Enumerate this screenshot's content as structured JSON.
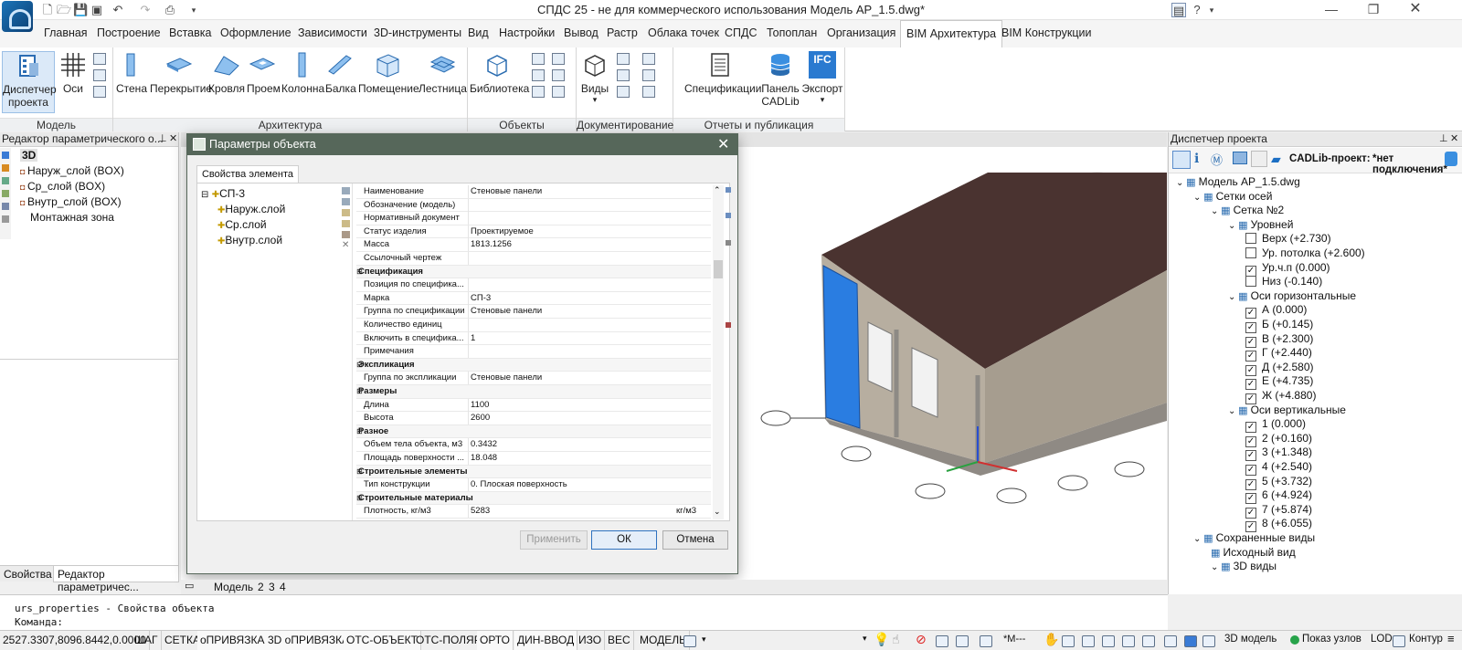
{
  "window": {
    "title": "СПДС 25 - не для коммерческого использования Модель AP_1.5.dwg*"
  },
  "menu_tabs": [
    "Главная",
    "Построение",
    "Вставка",
    "Оформление",
    "Зависимости",
    "3D-инструменты",
    "Вид",
    "Настройки",
    "Вывод",
    "Растр",
    "Облака точек",
    "СПДС",
    "Топоплан",
    "Организация",
    "BIM Архитектура",
    "BIM Конструкции"
  ],
  "active_tab": "BIM Архитектура",
  "ribbon": {
    "model": {
      "title": "Модель",
      "dispatcher": "Диспетчер\nпроекта",
      "axes": "Оси"
    },
    "architecture": {
      "title": "Архитектура",
      "buttons": [
        "Стена",
        "Перекрытие",
        "Кровля",
        "Проем",
        "Колонна",
        "Балка",
        "Помещение",
        "Лестница"
      ]
    },
    "objects": {
      "title": "Объекты",
      "library": "Библиотека"
    },
    "documentation": {
      "title": "Документирование",
      "views": "Виды"
    },
    "reports": {
      "title": "Отчеты и публикация",
      "specs": "Спецификации",
      "cadlib": "Панель\nCADLib",
      "export": "Экспорт",
      "ifc_label": "IFC"
    }
  },
  "left_panel": {
    "title": "Редактор параметрического о...",
    "root": "3D",
    "items": [
      "Наруж_слой (BOX)",
      "Ср_слой (BOX)",
      "Внутр_слой (BOX)",
      "Монтажная зона"
    ],
    "bottom_tabs": [
      "Свойства",
      "Редактор параметричес..."
    ]
  },
  "model_tabs": [
    "Модель",
    "2",
    "3",
    "4"
  ],
  "dialog": {
    "title": "Параметры объекта",
    "tab": "Свойства элемента",
    "tree_root": "СП-3",
    "tree_children": [
      "Наруж.слой",
      "Ср.слой",
      "Внутр.слой"
    ],
    "rows": [
      {
        "k": "Наименование",
        "v": "Стеновые панели"
      },
      {
        "k": "Обозначение (модель)",
        "v": ""
      },
      {
        "k": "Нормативный документ",
        "v": ""
      },
      {
        "k": "Статус изделия",
        "v": "Проектируемое"
      },
      {
        "k": "Масса",
        "v": "1813.1256"
      },
      {
        "k": "Ссылочный чертеж",
        "v": ""
      },
      {
        "k": "Спецификация",
        "v": "",
        "sec": true
      },
      {
        "k": "Позиция по специфика...",
        "v": ""
      },
      {
        "k": "Марка",
        "v": "СП-3"
      },
      {
        "k": "Группа по спецификации",
        "v": "Стеновые панели"
      },
      {
        "k": "Количество единиц",
        "v": ""
      },
      {
        "k": "Включить в специфика...",
        "v": "1"
      },
      {
        "k": "Примечания",
        "v": ""
      },
      {
        "k": "Экспликация",
        "v": "",
        "sec": true
      },
      {
        "k": "Группа по экспликации",
        "v": "Стеновые панели"
      },
      {
        "k": "Размеры",
        "v": "",
        "sec": true
      },
      {
        "k": "Длина",
        "v": "1100"
      },
      {
        "k": "Высота",
        "v": "2600"
      },
      {
        "k": "Разное",
        "v": "",
        "sec": true
      },
      {
        "k": "Объем тела объекта, м3",
        "v": "0.3432"
      },
      {
        "k": "Площадь поверхности ...",
        "v": "18.048"
      },
      {
        "k": "Строительные элементы",
        "v": "",
        "sec": true
      },
      {
        "k": "Тип конструкции",
        "v": "0. Плоская поверхность"
      },
      {
        "k": "Строительные материалы",
        "v": "",
        "sec": true
      },
      {
        "k": "Плотность, кг/м3",
        "v": "5283",
        "unit": "кг/м3"
      }
    ],
    "apply": "Применить",
    "ok": "ОК",
    "cancel": "Отмена"
  },
  "right_panel": {
    "title": "Диспетчер проекта",
    "cadlib_label": "CADLib-проект:",
    "cadlib_status": "*нет подключения*",
    "tree": [
      {
        "t": "Модель АР_1.5.dwg",
        "lvl": 0,
        "exp": "v"
      },
      {
        "t": "Сетки осей",
        "lvl": 1,
        "exp": "v"
      },
      {
        "t": "Сетка №2",
        "lvl": 2,
        "exp": "v"
      },
      {
        "t": "Уровней",
        "lvl": 3,
        "exp": "v"
      },
      {
        "t": "Верх (+2.730)",
        "lvl": 4,
        "chk": false
      },
      {
        "t": "Ур. потолка (+2.600)",
        "lvl": 4,
        "chk": false
      },
      {
        "t": "Ур.ч.п (0.000)",
        "lvl": 4,
        "chk": true
      },
      {
        "t": "Низ (-0.140)",
        "lvl": 4,
        "chk": false
      },
      {
        "t": "Оси горизонтальные",
        "lvl": 3,
        "exp": "v"
      },
      {
        "t": "А (0.000)",
        "lvl": 4,
        "chk": true
      },
      {
        "t": "Б (+0.145)",
        "lvl": 4,
        "chk": true
      },
      {
        "t": "В (+2.300)",
        "lvl": 4,
        "chk": true
      },
      {
        "t": "Г (+2.440)",
        "lvl": 4,
        "chk": true
      },
      {
        "t": "Д (+2.580)",
        "lvl": 4,
        "chk": true
      },
      {
        "t": "Е (+4.735)",
        "lvl": 4,
        "chk": true
      },
      {
        "t": "Ж (+4.880)",
        "lvl": 4,
        "chk": true
      },
      {
        "t": "Оси вертикальные",
        "lvl": 3,
        "exp": "v"
      },
      {
        "t": "1 (0.000)",
        "lvl": 4,
        "chk": true
      },
      {
        "t": "2 (+0.160)",
        "lvl": 4,
        "chk": true
      },
      {
        "t": "3 (+1.348)",
        "lvl": 4,
        "chk": true
      },
      {
        "t": "4 (+2.540)",
        "lvl": 4,
        "chk": true
      },
      {
        "t": "5 (+3.732)",
        "lvl": 4,
        "chk": true
      },
      {
        "t": "6 (+4.924)",
        "lvl": 4,
        "chk": true
      },
      {
        "t": "7 (+5.874)",
        "lvl": 4,
        "chk": true
      },
      {
        "t": "8 (+6.055)",
        "lvl": 4,
        "chk": true
      },
      {
        "t": "Сохраненные виды",
        "lvl": 1,
        "exp": "v"
      },
      {
        "t": "Исходный вид",
        "lvl": 2
      },
      {
        "t": "3D виды",
        "lvl": 2,
        "exp": "v"
      }
    ]
  },
  "command": {
    "line1": "urs_properties - Свойства объекта",
    "prompt": "Команда:"
  },
  "status": {
    "coords": "2527.3307,8096.8442,0.0000",
    "buttons": [
      "ШАГ",
      "СЕТКА",
      "оПРИВЯЗКА",
      "3D оПРИВЯЗКА",
      "ОТС-ОБЪЕКТ",
      "ОТС-ПОЛЯР",
      "ОРТО",
      "ДИН-ВВОД",
      "ИЗО",
      "ВЕС"
    ],
    "model": "МОДЕЛЬ",
    "scale": "*М---",
    "model3d": "3D модель",
    "show_nodes": "Показ узлов",
    "lod": "LOD",
    "contour": "Контур"
  },
  "colors": {
    "dialog_title": "#56675a",
    "accent_blue": "#1f6fbf",
    "roof": "#4a3330",
    "wall": "#b7aea0",
    "panel_blue": "#2a7de1"
  }
}
